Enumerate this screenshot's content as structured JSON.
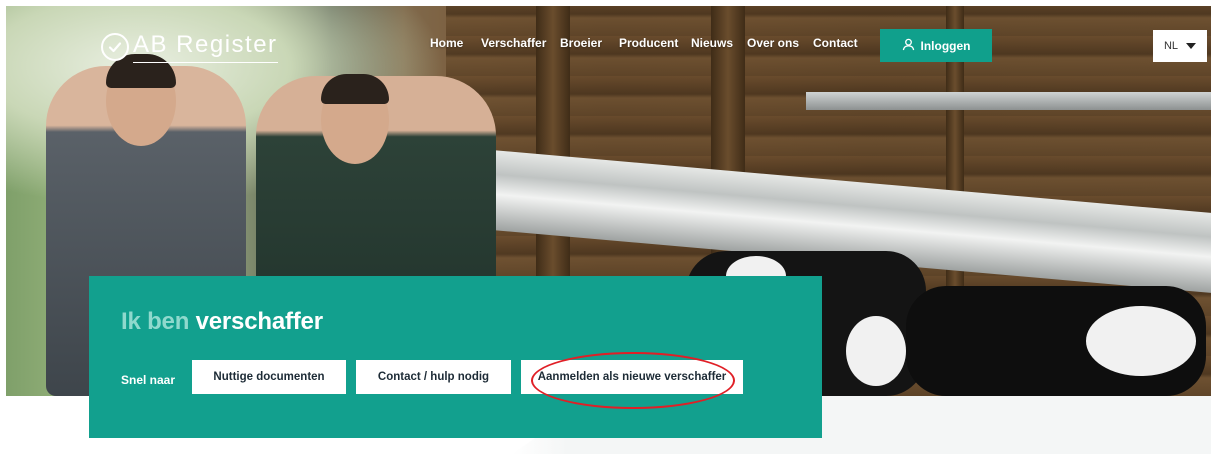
{
  "brand": {
    "logo_text": "AB Register"
  },
  "nav": {
    "items": [
      {
        "label": "Home"
      },
      {
        "label": "Verschaffer"
      },
      {
        "label": "Broeier"
      },
      {
        "label": "Producent"
      },
      {
        "label": "Nieuws"
      },
      {
        "label": "Over ons"
      },
      {
        "label": "Contact"
      }
    ],
    "login_label": "Inloggen",
    "language": "NL"
  },
  "hero": {
    "title_light": "Ik ben",
    "title_bold": "verschaffer",
    "quick_label": "Snel naar",
    "quick_links": [
      {
        "label": "Nuttige documenten"
      },
      {
        "label": "Contact / hulp nodig"
      },
      {
        "label": "Aanmelden als nieuwe verschaffer"
      }
    ]
  },
  "colors": {
    "accent": "#12a08e",
    "accent_light": "#8fd9cd",
    "annotation": "#e01f26"
  }
}
